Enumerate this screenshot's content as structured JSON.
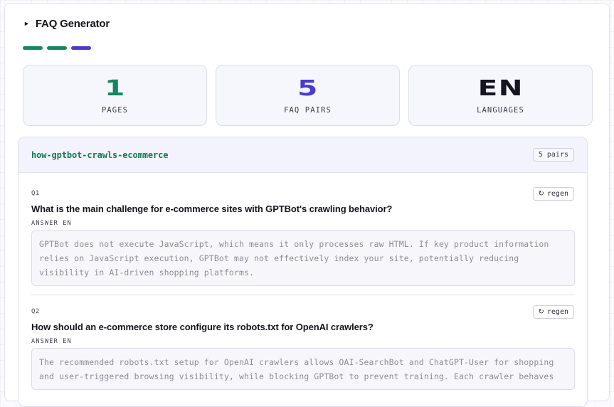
{
  "header": {
    "title": "FAQ Generator",
    "caret": "►"
  },
  "steps": [
    {
      "color": "#12885c"
    },
    {
      "color": "#12885c"
    },
    {
      "color": "#4a3bd0"
    }
  ],
  "stats": [
    {
      "value": "1",
      "label": "PAGES",
      "color": "#12885c"
    },
    {
      "value": "5",
      "label": "FAQ PAIRS",
      "color": "#4a3bd0"
    },
    {
      "value": "EN",
      "label": "LANGUAGES",
      "color": "#15151f"
    }
  ],
  "page_card": {
    "slug": "how-gptbot-crawls-ecommerce",
    "pairs_badge": "5 pairs",
    "answer_label": "ANSWER EN",
    "regen_label": "regen",
    "regen_icon": "↻",
    "items": [
      {
        "num": "Q1",
        "question": "What is the main challenge for e-commerce sites with GPTBot's crawling behavior?",
        "answer": "GPTBot does not execute JavaScript, which means it only processes raw HTML. If key product information relies on JavaScript execution, GPTBot may not effectively index your site, potentially reducing visibility in AI-driven shopping platforms."
      },
      {
        "num": "Q2",
        "question": "How should an e-commerce store configure its robots.txt for OpenAI crawlers?",
        "answer": "The recommended robots.txt setup for OpenAI crawlers allows OAI-SearchBot and ChatGPT-User for shopping and user-triggered browsing visibility, while blocking GPTBot to prevent training. Each crawler behaves"
      }
    ]
  }
}
